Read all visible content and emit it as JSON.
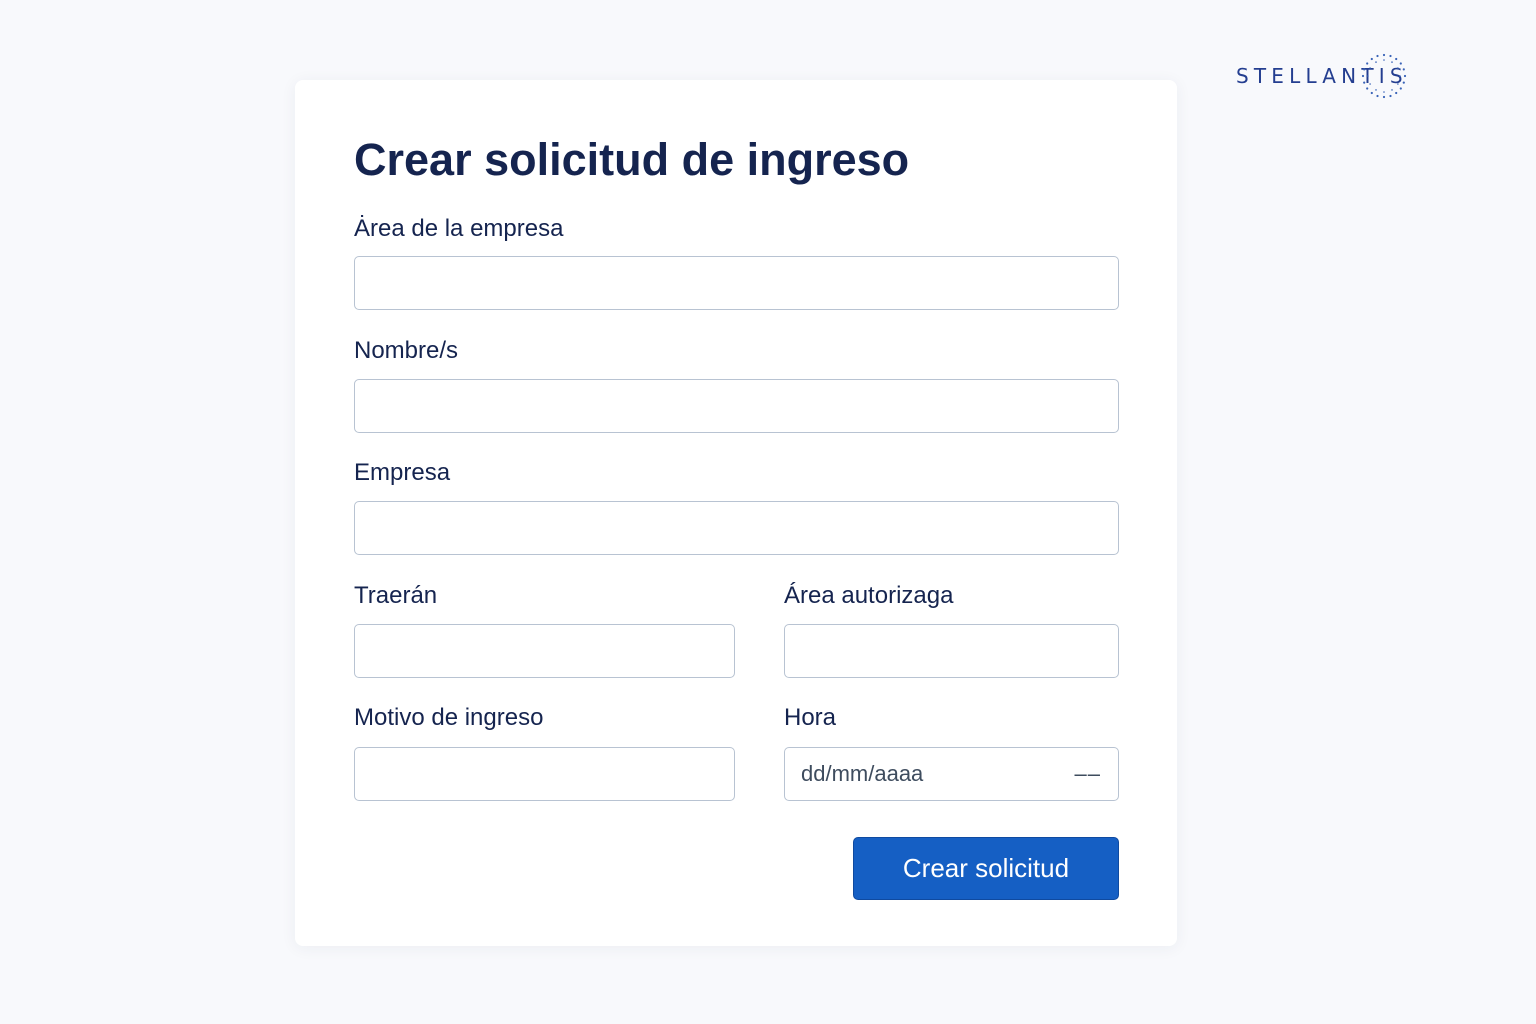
{
  "brand": {
    "name": "STELLANTIS",
    "logo_icon": "stellantis-dotted-ring",
    "color": "#243e90"
  },
  "form": {
    "title": "Crear solicitud de ingreso",
    "fields": {
      "area_empresa": {
        "label": "Ȧrea de la empresa",
        "value": ""
      },
      "nombres": {
        "label": "Nombre/s",
        "value": ""
      },
      "empresa": {
        "label": "Empresa",
        "value": ""
      },
      "traeran": {
        "label": "Traerán",
        "value": ""
      },
      "area_autorizada": {
        "label": "Área autorizaga",
        "value": ""
      },
      "motivo_ingreso": {
        "label": "Motivo de ingreso",
        "value": ""
      },
      "hora": {
        "label": "Hora",
        "placeholder": "dd/mm/aaaa",
        "time_placeholder": "––",
        "value": ""
      }
    },
    "submit_label": "Crear solicitud"
  },
  "colors": {
    "background": "#f8f9fc",
    "text": "#15244f",
    "input_border": "#b8c3d2",
    "primary_button": "#155fc4"
  }
}
